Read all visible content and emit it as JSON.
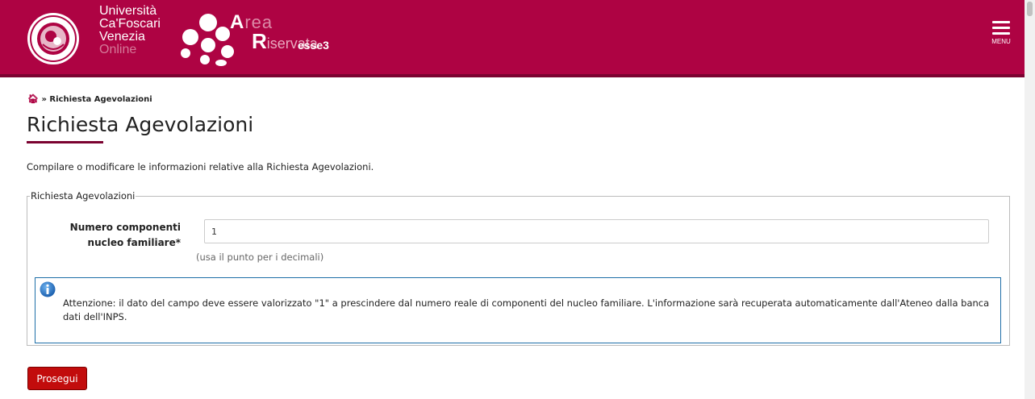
{
  "header": {
    "university_lines": [
      "Università",
      "Ca'Foscari",
      "Venezia",
      "Online"
    ],
    "area_word": {
      "first": "A",
      "rest": "rea"
    },
    "riservata_word": {
      "first": "R",
      "rest": "iservata"
    },
    "esse3": "esse3",
    "menu_label": "MENU",
    "colors": {
      "brand": "#ae0343",
      "brand_dark": "#7b0230"
    }
  },
  "breadcrumb": {
    "home_icon": "home-icon",
    "separator": "»",
    "current": "Richiesta Agevolazioni"
  },
  "page": {
    "title": "Richiesta Agevolazioni",
    "intro": "Compilare o modificare le informazioni relative alla Richiesta Agevolazioni."
  },
  "form": {
    "legend": "Richiesta Agevolazioni",
    "field": {
      "label_line1": "Numero componenti",
      "label_line2": "nucleo familiare*",
      "value": "1",
      "help": "(usa il punto per i decimali)"
    },
    "info": {
      "icon": "info-icon",
      "text": "Attenzione: il dato del campo deve essere valorizzato \"1\" a prescindere dal numero reale di componenti del nucleo familiare. L'informazione sarà recuperata automaticamente dall'Ateneo dalla banca dati dell'INPS."
    },
    "submit_label": "Prosegui",
    "submit_color": "#c20c0c"
  }
}
